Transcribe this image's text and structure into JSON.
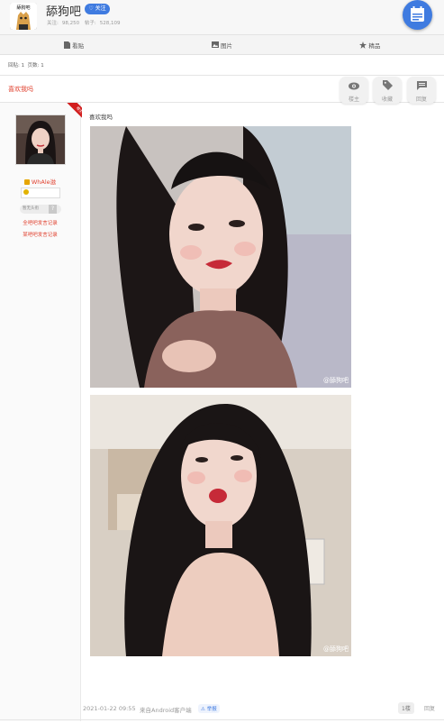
{
  "header": {
    "logo_text": "舔狗吧",
    "forum_name": "舔狗吧",
    "follow_label": "关注",
    "stats": {
      "followers_label": "关注:",
      "followers": "98,250",
      "posts_label": "帖子:",
      "posts": "528,109"
    }
  },
  "tabs": [
    {
      "icon": "document-icon",
      "label": "看贴"
    },
    {
      "icon": "image-icon",
      "label": "图片"
    },
    {
      "icon": "star-icon",
      "label": "精品"
    }
  ],
  "meta": {
    "reply_label": "回贴:",
    "reply_count": "1",
    "page_label": "页数:",
    "page_count": "1"
  },
  "thread": {
    "title": "喜欢我吗",
    "actions": [
      {
        "icon": "eye-icon",
        "label": "楼主"
      },
      {
        "icon": "tag-icon",
        "label": "收藏"
      },
      {
        "icon": "comment-icon",
        "label": "回复"
      }
    ]
  },
  "author": {
    "name": "WhAle滋",
    "badge_text": "楼主",
    "no_title": "暂无头衔",
    "help_mark": "?",
    "links": [
      "全吧吧发言记录",
      "某吧吧发言记录"
    ]
  },
  "post": {
    "text": "喜欢我吗",
    "watermark_1": "@舔狗吧",
    "watermark_2": "@舔狗吧",
    "time": "2021-01-22 09:55",
    "client": "来自Android客户端",
    "report": "举报",
    "floor": "1楼",
    "reply": "回复"
  },
  "colors": {
    "accent": "#3f7be0",
    "title_red": "#e0412f",
    "badge_red": "#d21f1f"
  }
}
